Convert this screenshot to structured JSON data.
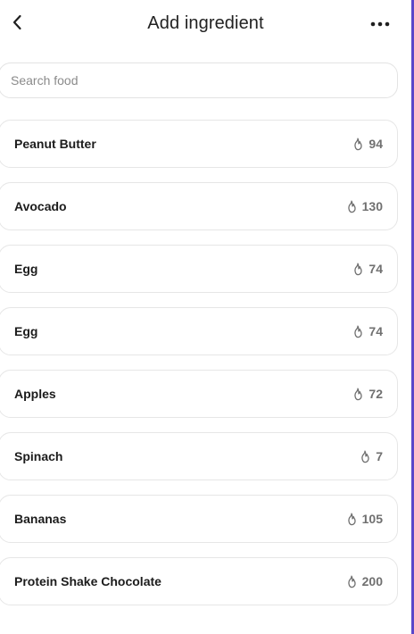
{
  "header": {
    "title": "Add ingredient",
    "back_icon": "chevron-left-icon",
    "more_icon": "more-horizontal-icon"
  },
  "search": {
    "placeholder": "Search food",
    "value": ""
  },
  "colors": {
    "accent_edge": "#5b46c9",
    "card_border": "#e6e6e6",
    "calorie_text": "#707070"
  },
  "foods": [
    {
      "name": "Peanut Butter",
      "calories": "94"
    },
    {
      "name": "Avocado",
      "calories": "130"
    },
    {
      "name": "Egg",
      "calories": "74"
    },
    {
      "name": "Egg",
      "calories": "74"
    },
    {
      "name": "Apples",
      "calories": "72"
    },
    {
      "name": "Spinach",
      "calories": "7"
    },
    {
      "name": "Bananas",
      "calories": "105"
    },
    {
      "name": "Protein Shake Chocolate",
      "calories": "200"
    }
  ]
}
